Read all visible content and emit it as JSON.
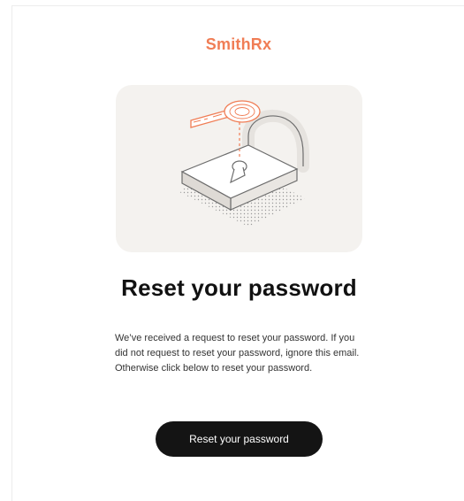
{
  "brand": {
    "name": "SmithRx"
  },
  "email": {
    "title": "Reset your password",
    "body": "We’ve received a request to reset your password. If you did not request to reset your password, ignore this email. Otherwise click below to reset your password.",
    "button_label": "Reset your password"
  },
  "colors": {
    "brand": "#f07d55",
    "button_bg": "#141414",
    "hero_bg": "#f4f2ef"
  },
  "icons": {
    "hero": "padlock-with-key-icon"
  }
}
